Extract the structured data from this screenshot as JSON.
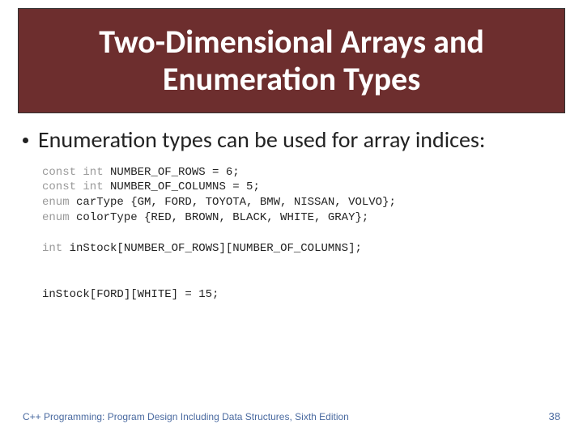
{
  "title": "Two-Dimensional Arrays and Enumeration Types",
  "bullet": "Enumeration types can be used for array indices:",
  "code": {
    "l1a": "const int",
    "l1b": " NUMBER_OF_ROWS = 6;",
    "l2a": "const int",
    "l2b": " NUMBER_OF_COLUMNS = 5;",
    "l3a": "enum",
    "l3b": " carType {GM, FORD, TOYOTA, BMW, NISSAN, VOLVO};",
    "l4a": "enum",
    "l4b": " colorType {RED, BROWN, BLACK, WHITE, GRAY};",
    "l5a": "int",
    "l5b": " inStock[NUMBER_OF_ROWS][NUMBER_OF_COLUMNS];",
    "l6": "inStock[FORD][WHITE] = 15;"
  },
  "footer": {
    "book": "C++ Programming: Program Design Including Data Structures, Sixth Edition",
    "page": "38"
  }
}
